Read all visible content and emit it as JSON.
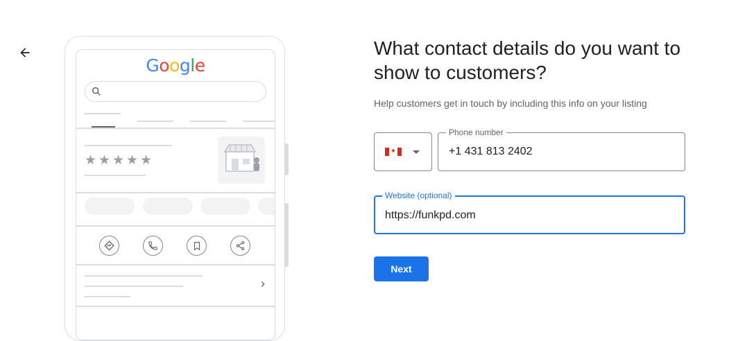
{
  "nav": {
    "back_icon": "arrow-back-icon"
  },
  "preview": {
    "logo_letters": [
      {
        "char": "G",
        "color": "#4285F4"
      },
      {
        "char": "o",
        "color": "#EA4335"
      },
      {
        "char": "o",
        "color": "#FBBC05"
      },
      {
        "char": "g",
        "color": "#4285F4"
      },
      {
        "char": "l",
        "color": "#34A853"
      },
      {
        "char": "e",
        "color": "#EA4335"
      }
    ],
    "rating_stars": 5,
    "action_icons": [
      "directions-icon",
      "phone-icon",
      "bookmark-icon",
      "share-icon"
    ]
  },
  "form": {
    "title": "What contact details do you want to show to customers?",
    "subtitle": "Help customers get in touch by including this info on your listing",
    "country": {
      "flag": "canada-flag-icon"
    },
    "phone": {
      "label": "Phone number",
      "value": "+1 431 813 2402"
    },
    "website": {
      "label": "Website (optional)",
      "value": "https://funkpd.com"
    },
    "next_label": "Next"
  },
  "colors": {
    "accent": "#1a73e8",
    "border": "#80868b",
    "muted": "#5f6368"
  }
}
